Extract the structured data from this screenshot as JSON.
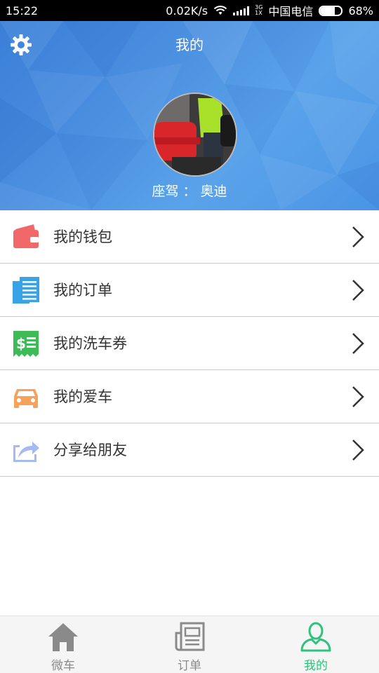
{
  "status_bar": {
    "time": "15:22",
    "speed": "0.02K/s",
    "net_type_top": "3G",
    "net_type_bottom": "1X",
    "carrier": "中国电信",
    "battery_text": "68%",
    "battery_level": 0.68
  },
  "header": {
    "title": "我的",
    "driver_label": "座驾",
    "driver_sep": "：",
    "driver_value": "奥迪"
  },
  "menu": {
    "items": [
      {
        "label": "我的钱包",
        "icon": "wallet-icon",
        "color": "#f0686a"
      },
      {
        "label": "我的订单",
        "icon": "order-document-icon",
        "color": "#3aa3e8"
      },
      {
        "label": "我的洗车券",
        "icon": "car-wash-coupon-icon",
        "color": "#3dbb57"
      },
      {
        "label": "我的爱车",
        "icon": "car-icon",
        "color": "#f5a25a"
      },
      {
        "label": "分享给朋友",
        "icon": "share-icon",
        "color": "#a4baf0"
      }
    ]
  },
  "bottom_nav": {
    "items": [
      {
        "label": "微车",
        "icon": "home-icon"
      },
      {
        "label": "订单",
        "icon": "newspaper-icon"
      },
      {
        "label": "我的",
        "icon": "user-icon"
      }
    ],
    "active_color": "#2ec27e",
    "inactive_color": "#8a8a8a"
  }
}
